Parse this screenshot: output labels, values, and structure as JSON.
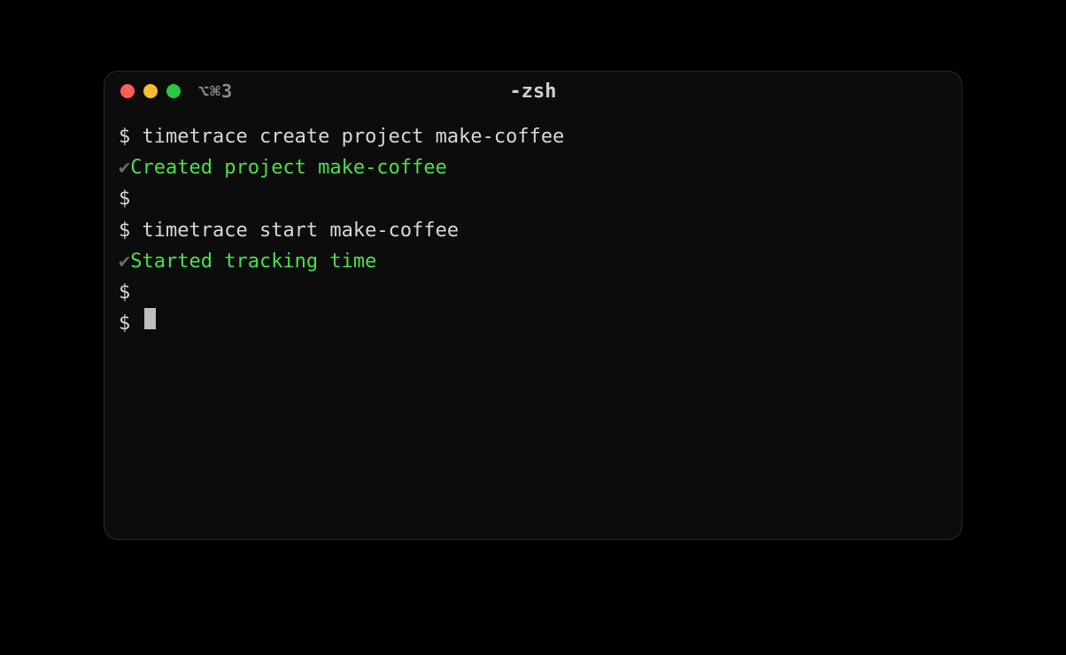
{
  "window": {
    "title": "-zsh",
    "tabIndicator": "⌥⌘3"
  },
  "terminal": {
    "prompt": "$ ",
    "checkmark": "✔",
    "lines": [
      {
        "type": "command",
        "text": "timetrace create project make-coffee"
      },
      {
        "type": "success",
        "text": "Created project make-coffee"
      },
      {
        "type": "empty-prompt",
        "text": ""
      },
      {
        "type": "command",
        "text": "timetrace start make-coffee"
      },
      {
        "type": "success",
        "text": "Started tracking time"
      },
      {
        "type": "empty-prompt",
        "text": ""
      },
      {
        "type": "cursor-prompt",
        "text": ""
      }
    ]
  }
}
